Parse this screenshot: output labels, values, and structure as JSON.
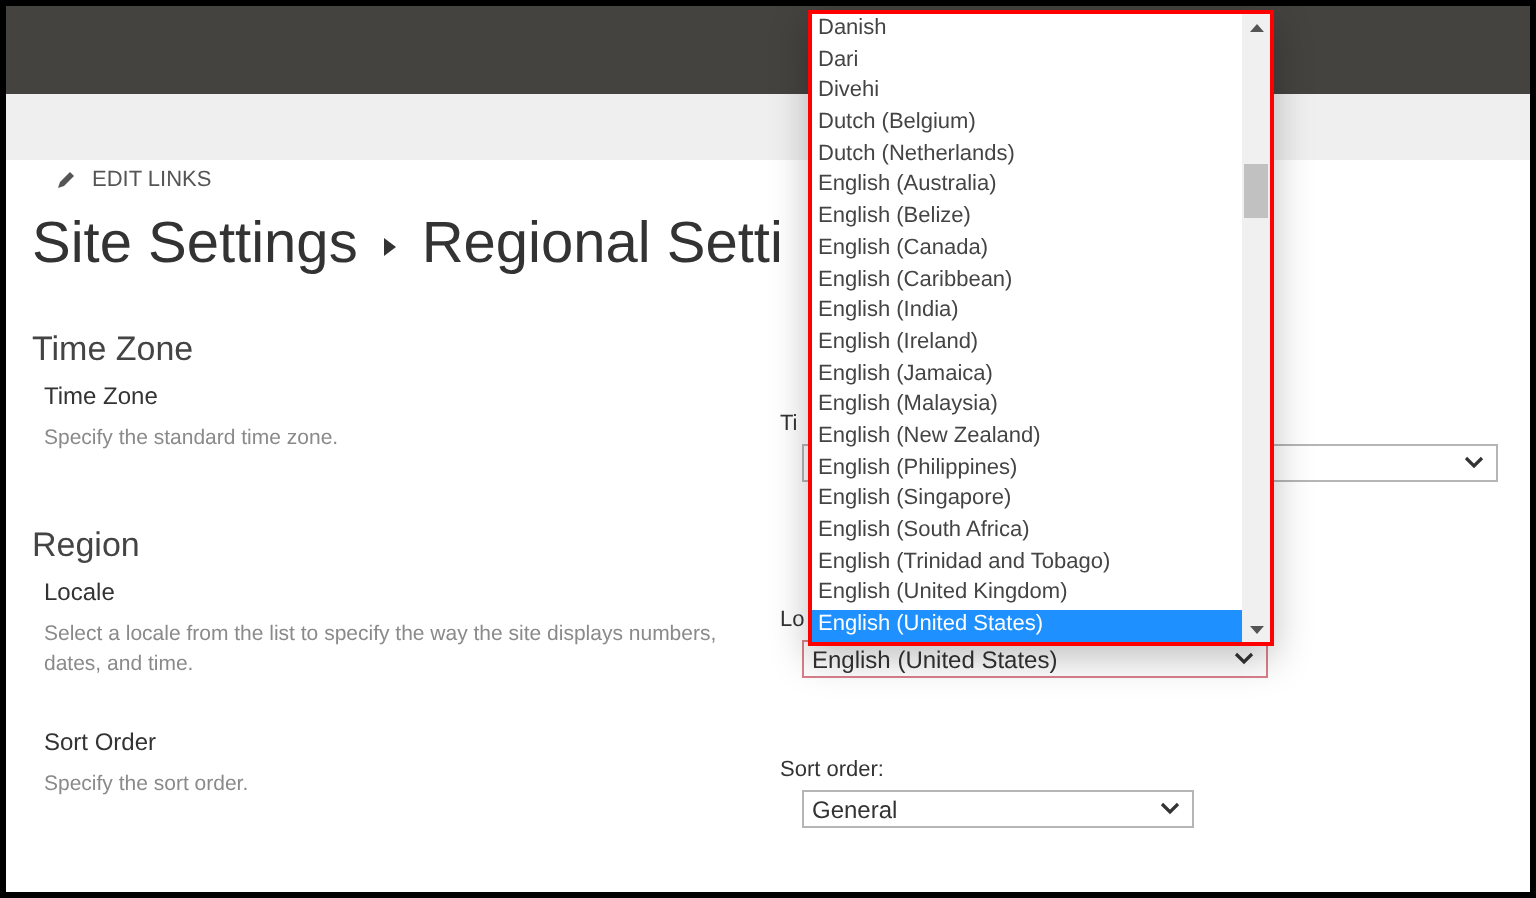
{
  "edit_links": "EDIT LINKS",
  "title": {
    "parent": "Site Settings",
    "current": "Regional Setti"
  },
  "sections": [
    {
      "heading": "Time Zone",
      "fields": [
        {
          "label": "Time Zone",
          "description": "Specify the standard time zone.",
          "control_label": "Ti",
          "focused": false
        }
      ]
    },
    {
      "heading": "Region",
      "fields": [
        {
          "label": "Locale",
          "description": "Select a locale from the list to specify the way the site displays numbers, dates, and time.",
          "control_label": "Lo",
          "value": "English (United States)",
          "focused": true
        },
        {
          "label": "Sort Order",
          "description": "Specify the sort order.",
          "control_label": "Sort order:",
          "value": "General",
          "focused": false
        }
      ]
    }
  ],
  "locale_list": [
    {
      "label": "Danish",
      "selected": false
    },
    {
      "label": "Dari",
      "selected": false
    },
    {
      "label": "Divehi",
      "selected": false
    },
    {
      "label": "Dutch (Belgium)",
      "selected": false
    },
    {
      "label": "Dutch (Netherlands)",
      "selected": false
    },
    {
      "label": "English (Australia)",
      "selected": false
    },
    {
      "label": "English (Belize)",
      "selected": false
    },
    {
      "label": "English (Canada)",
      "selected": false
    },
    {
      "label": "English (Caribbean)",
      "selected": false
    },
    {
      "label": "English (India)",
      "selected": false
    },
    {
      "label": "English (Ireland)",
      "selected": false
    },
    {
      "label": "English (Jamaica)",
      "selected": false
    },
    {
      "label": "English (Malaysia)",
      "selected": false
    },
    {
      "label": "English (New Zealand)",
      "selected": false
    },
    {
      "label": "English (Philippines)",
      "selected": false
    },
    {
      "label": "English (Singapore)",
      "selected": false
    },
    {
      "label": "English (South Africa)",
      "selected": false
    },
    {
      "label": "English (Trinidad and Tobago)",
      "selected": false
    },
    {
      "label": "English (United Kingdom)",
      "selected": false
    },
    {
      "label": "English (United States)",
      "selected": true
    }
  ]
}
